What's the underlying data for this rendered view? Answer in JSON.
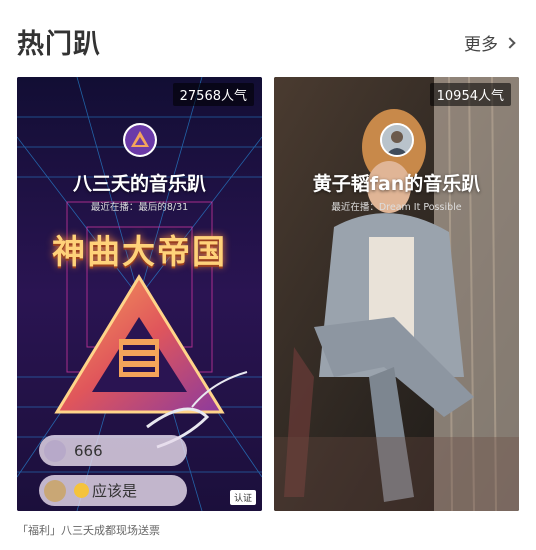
{
  "header": {
    "title": "热门趴",
    "more_label": "更多"
  },
  "rooms": [
    {
      "popularity": "27568人气",
      "name": "八三夭的音乐趴",
      "now_playing": "最近在播：最后的8/31",
      "poster_text": "神曲大帝国",
      "chat": [
        {
          "message": "666"
        },
        {
          "message": "应该是"
        }
      ],
      "verify_label": "认证"
    },
    {
      "popularity": "10954人气",
      "name": "黄子韬fan的音乐趴",
      "now_playing": "最近在播：Dream It Possible"
    }
  ],
  "caption": "「福利」八三夭成都现场送票"
}
